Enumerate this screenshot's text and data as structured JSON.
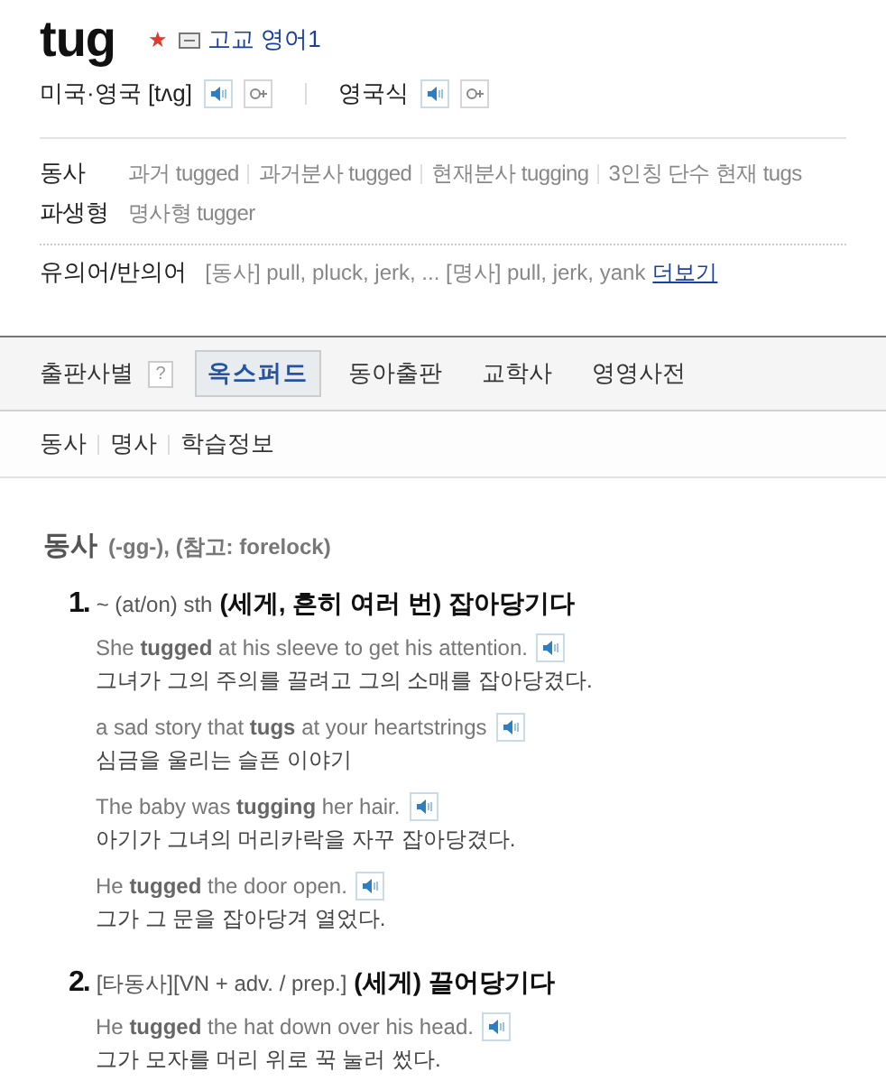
{
  "headword": {
    "word": "tug",
    "star": "★",
    "level": "고교 영어1"
  },
  "pronunciations": [
    {
      "label": "미국·영국 [tʌg]"
    },
    {
      "label": "영국식"
    }
  ],
  "forms": {
    "label": "동사",
    "items": [
      "과거 tugged",
      "과거분사 tugged",
      "현재분사 tugging",
      "3인칭 단수 현재 tugs"
    ]
  },
  "derivative": {
    "label": "파생형",
    "text": "명사형 tugger"
  },
  "synonyms": {
    "label": "유의어/반의어",
    "text": "[동사] pull, pluck, jerk, ... [명사] pull, jerk, yank",
    "more": "더보기"
  },
  "publisher_tabs": {
    "label": "출판사별",
    "help": "?",
    "tabs": [
      {
        "label": "옥스퍼드",
        "selected": true
      },
      {
        "label": "동아출판",
        "selected": false
      },
      {
        "label": "교학사",
        "selected": false
      },
      {
        "label": "영영사전",
        "selected": false
      }
    ]
  },
  "sections": [
    "동사",
    "명사",
    "학습정보"
  ],
  "entry": {
    "pos": "동사",
    "note": "(-gg-), (참고: forelock)",
    "senses": [
      {
        "number": "1.",
        "pattern": "~ (at/on) sth",
        "meaning": "(세게, 흔히 여러 번) 잡아당기다",
        "examples": [
          {
            "en": "She **tugged** at his sleeve to get his attention.",
            "ko": "그녀가 그의 주의를 끌려고 그의 소매를 잡아당겼다."
          },
          {
            "en": "a sad story that **tugs** at your heartstrings",
            "ko": "심금을 울리는 슬픈 이야기"
          },
          {
            "en": "The baby was **tugging** her hair.",
            "ko": "아기가 그녀의 머리카락을 자꾸 잡아당겼다."
          },
          {
            "en": "He **tugged** the door open.",
            "ko": "그가 그 문을 잡아당겨 열었다."
          }
        ]
      },
      {
        "number": "2.",
        "pattern": "[타동사][VN + adv. / prep.]",
        "meaning": "(세게) 끌어당기다",
        "examples": [
          {
            "en": "He **tugged** the hat down over his head.",
            "ko": "그가 모자를 머리 위로 꾹 눌러 썼다."
          }
        ]
      }
    ]
  }
}
